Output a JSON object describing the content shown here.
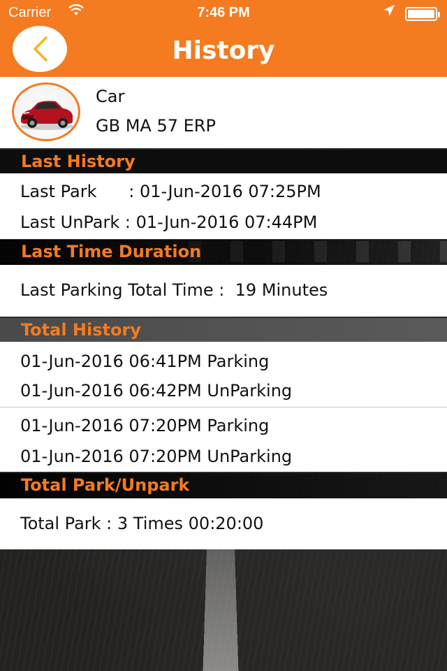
{
  "status_bar": {
    "carrier": "Carrier",
    "time": "7:46 PM",
    "wifi_icon": "wifi-icon",
    "location_icon": "location-arrow-icon",
    "battery_icon": "battery-icon"
  },
  "nav": {
    "title": "History",
    "back_icon": "chevron-left-icon"
  },
  "vehicle": {
    "name": "Car",
    "plate": "GB MA 57 ERP",
    "avatar_icon": "car-icon"
  },
  "sections": {
    "last_history": {
      "title": "Last History",
      "last_park": "Last Park      : 01-Jun-2016 07:25PM",
      "last_unpark": "Last UnPark : 01-Jun-2016 07:44PM"
    },
    "last_duration": {
      "title": "Last Time Duration",
      "total_time": "Last Parking Total Time :  19 Minutes"
    },
    "total_history": {
      "title": "Total History",
      "entries": [
        {
          "parking": "01-Jun-2016 06:41PM Parking",
          "unparking": "01-Jun-2016 06:42PM UnParking"
        },
        {
          "parking": "01-Jun-2016 07:20PM Parking",
          "unparking": "01-Jun-2016 07:20PM UnParking"
        }
      ]
    },
    "total_park": {
      "title": "Total Park/Unpark",
      "summary": "Total Park : 3 Times 00:20:00"
    }
  },
  "colors": {
    "accent": "#f47b20",
    "panel": "#ffffff",
    "text": "#111111"
  }
}
